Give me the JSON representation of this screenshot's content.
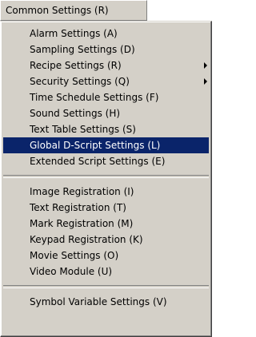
{
  "menubar": {
    "label": "Common Settings (R)"
  },
  "menu": {
    "group1": [
      {
        "label": "Alarm Settings (A)"
      },
      {
        "label": "Sampling Settings (D)"
      },
      {
        "label": "Recipe Settings (R)",
        "submenu": true
      },
      {
        "label": "Security Settings (Q)",
        "submenu": true
      },
      {
        "label": "Time Schedule Settings (F)"
      },
      {
        "label": "Sound Settings (H)"
      },
      {
        "label": "Text Table Settings (S)"
      },
      {
        "label": "Global D-Script Settings (L)",
        "selected": true
      },
      {
        "label": "Extended Script Settings (E)"
      }
    ],
    "group2": [
      {
        "label": "Image Registration (I)"
      },
      {
        "label": "Text Registration (T)"
      },
      {
        "label": "Mark Registration (M)"
      },
      {
        "label": "Keypad Registration (K)"
      },
      {
        "label": "Movie Settings (O)"
      },
      {
        "label": "Video Module (U)"
      }
    ],
    "group3": [
      {
        "label": "Symbol Variable Settings (V)"
      }
    ]
  },
  "colors": {
    "menu_background": "#d4d0c8",
    "selection_background": "#0a246a",
    "selection_text": "#ffffff"
  }
}
